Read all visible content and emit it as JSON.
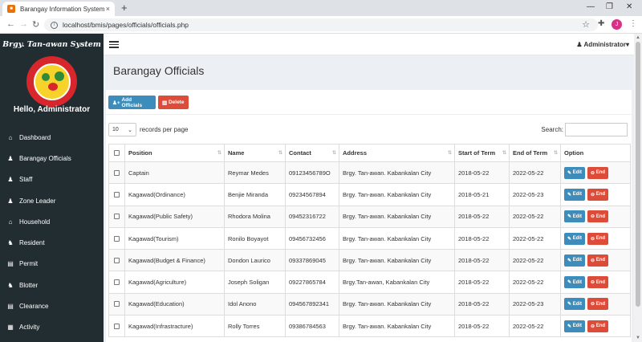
{
  "browser": {
    "tab_title": "Barangay Information System",
    "tab_close": "×",
    "new_tab": "+",
    "url": "localhost/bmis/pages/officials/officials.php",
    "profile_initial": "J"
  },
  "sidebar": {
    "brand": "Brgy. Tan-awan System",
    "greeting": "Hello, Administrator",
    "items": [
      {
        "label": "Dashboard",
        "icon": "dashboard-icon",
        "glyph": "⌂"
      },
      {
        "label": "Barangay Officials",
        "icon": "user-icon",
        "glyph": "♟"
      },
      {
        "label": "Staff",
        "icon": "user-icon",
        "glyph": "♟"
      },
      {
        "label": "Zone Leader",
        "icon": "user-icon",
        "glyph": "♟"
      },
      {
        "label": "Household",
        "icon": "home-icon",
        "glyph": "⌂"
      },
      {
        "label": "Resident",
        "icon": "users-icon",
        "glyph": "♞"
      },
      {
        "label": "Permit",
        "icon": "file-icon",
        "glyph": "▤"
      },
      {
        "label": "Blotter",
        "icon": "users-icon",
        "glyph": "♞"
      },
      {
        "label": "Clearance",
        "icon": "file-icon",
        "glyph": "▤"
      },
      {
        "label": "Activity",
        "icon": "calendar-icon",
        "glyph": "▦"
      }
    ]
  },
  "header": {
    "user": "Administrator"
  },
  "main": {
    "title": "Barangay Officials",
    "add_label": "Add Officials",
    "delete_label": "Delete",
    "records_value": "10",
    "records_label": "records per page",
    "search_label": "Search:",
    "edit_label": "Edit",
    "end_label": "End"
  },
  "table": {
    "headers": [
      "Position",
      "Name",
      "Contact",
      "Address",
      "Start of Term",
      "End of Term",
      "Option"
    ],
    "rows": [
      [
        "Captain",
        "Reymar Medes",
        "09123456789O",
        "Brgy. Tan-awan. Kabankalan City",
        "2018-05-22",
        "2022-05-22"
      ],
      [
        "Kagawad(Ordinance)",
        "Benjie Miranda",
        "09234567894",
        "Brgy. Tan-awan. Kabankalan City",
        "2018-05-21",
        "2022-05-23"
      ],
      [
        "Kagawad(Public Safety)",
        "Rhodora Molina",
        "09452316722",
        "Brgy. Tan-awan. Kabankalan City",
        "2018-05-22",
        "2022-05-22"
      ],
      [
        "Kagawad(Tourism)",
        "Ronilo Boyayot",
        "09456732456",
        "Brgy. Tan-awan. Kabankalan City",
        "2018-05-22",
        "2022-05-22"
      ],
      [
        "Kagawad(Budget & Finance)",
        "Dondon Laurico",
        "09337869045",
        "Brgy. Tan-awan. Kabankalan City",
        "2018-05-22",
        "2022-05-22"
      ],
      [
        "Kagawad(Agriculture)",
        "Joseph Soligan",
        "09227865784",
        "Brgy.Tan-awan, Kabankalan City",
        "2018-05-22",
        "2022-05-22"
      ],
      [
        "Kagawad(Education)",
        "Idol Anono",
        "094567892341",
        "Brgy. Tan-awan. Kabankalan City",
        "2018-05-22",
        "2022-05-23"
      ],
      [
        "Kagawad(Infrastracture)",
        "Rolly Torres",
        "09386784563",
        "Brgy. Tan-awan. Kabankalan City",
        "2018-05-22",
        "2022-05-22"
      ]
    ]
  }
}
